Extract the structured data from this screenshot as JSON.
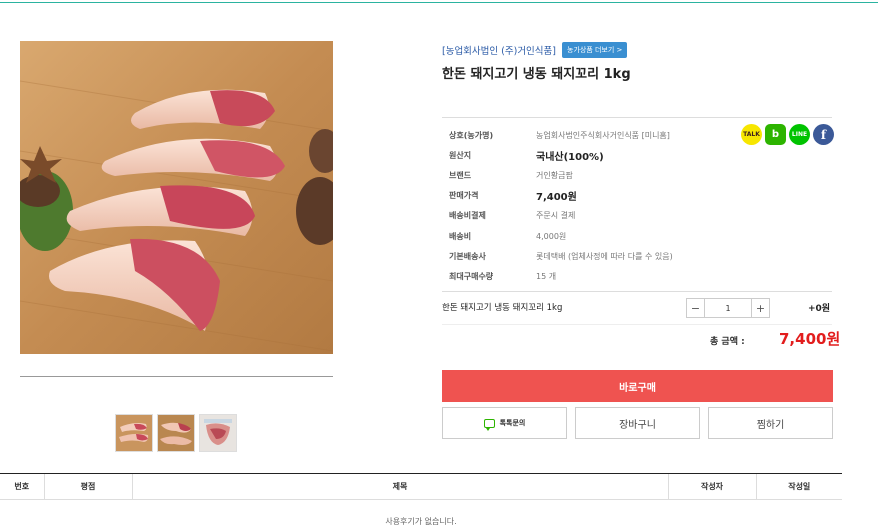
{
  "product": {
    "farm_name": "[농업회사법인 (주)거인식품]",
    "farm_button": "농가상품 더보기 >",
    "title": "한돈 돼지고기 냉동 돼지꼬리 1kg"
  },
  "info": [
    {
      "label": "상호(농가명)",
      "value": "농업회사법인주식회사거인식품 [미니홈]",
      "strong": false
    },
    {
      "label": "원산지",
      "value": "국내산(100%)",
      "strong": true
    },
    {
      "label": "브랜드",
      "value": "거인황금팜",
      "strong": false
    },
    {
      "label": "판매가격",
      "value": "7,400원",
      "strong": true
    },
    {
      "label": "배송비결제",
      "value": "주문시 결제",
      "strong": false
    },
    {
      "label": "배송비",
      "value": "4,000원",
      "strong": false
    },
    {
      "label": "기본배송사",
      "value": "롯데택배 (업체사정에 따라 다를 수 있음)",
      "strong": false
    },
    {
      "label": "최대구매수량",
      "value": "15 개",
      "strong": false
    }
  ],
  "sns": {
    "kakao": "TALK",
    "blog": "b",
    "line": "LINE",
    "facebook": "f"
  },
  "option": {
    "name": "한돈 돼지고기 냉동 돼지꼬리 1kg",
    "minus": "−",
    "plus": "+",
    "quantity": "1",
    "price": "+0원"
  },
  "total": {
    "label": "총 금액 :",
    "value": "7,400원"
  },
  "buttons": {
    "buy": "바로구매",
    "talk": "톡톡문의",
    "cart": "장바구니",
    "wish": "찜하기"
  },
  "reviews": {
    "columns": [
      "번호",
      "평점",
      "제목",
      "작성자",
      "작성일"
    ],
    "empty_message": "사용후기가 없습니다."
  }
}
